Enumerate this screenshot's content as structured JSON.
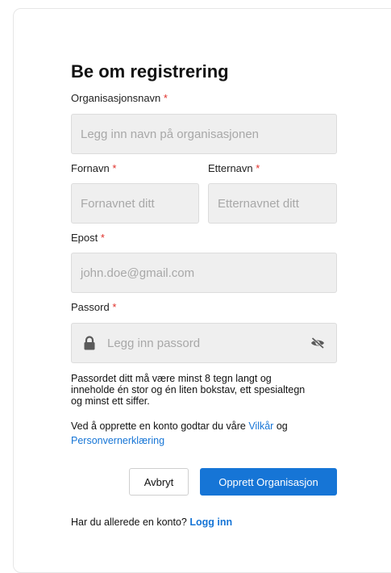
{
  "title": "Be om registrering",
  "fields": {
    "org_name": {
      "label": "Organisasjonsnavn",
      "required": "*",
      "placeholder": "Legg inn navn på organisasjonen"
    },
    "first_name": {
      "label": "Fornavn",
      "required": "*",
      "placeholder": "Fornavnet ditt"
    },
    "last_name": {
      "label": "Etternavn",
      "required": "*",
      "placeholder": "Etternavnet ditt"
    },
    "email": {
      "label": "Epost",
      "required": "*",
      "placeholder": "john.doe@gmail.com"
    },
    "password": {
      "label": "Passord",
      "required": "*",
      "placeholder": "Legg inn passord"
    }
  },
  "password_help": "Passordet ditt må være minst 8 tegn langt og inneholde én stor og én liten bokstav, ett spesialtegn og minst ett siffer.",
  "terms": {
    "prefix": "Ved å opprette en konto godtar du våre ",
    "terms_link": "Vilkår",
    "and": " og",
    "privacy_link": "Personvernerklæring"
  },
  "buttons": {
    "cancel": "Avbryt",
    "create": "Opprett Organisasjon"
  },
  "login": {
    "prefix": "Har du allerede en konto? ",
    "link": "Logg inn"
  },
  "icons": {
    "lock": "lock-icon",
    "eye": "eye-slash-icon"
  },
  "colors": {
    "accent": "#1675d6",
    "required": "#e0302a",
    "input_bg": "#efefef"
  }
}
